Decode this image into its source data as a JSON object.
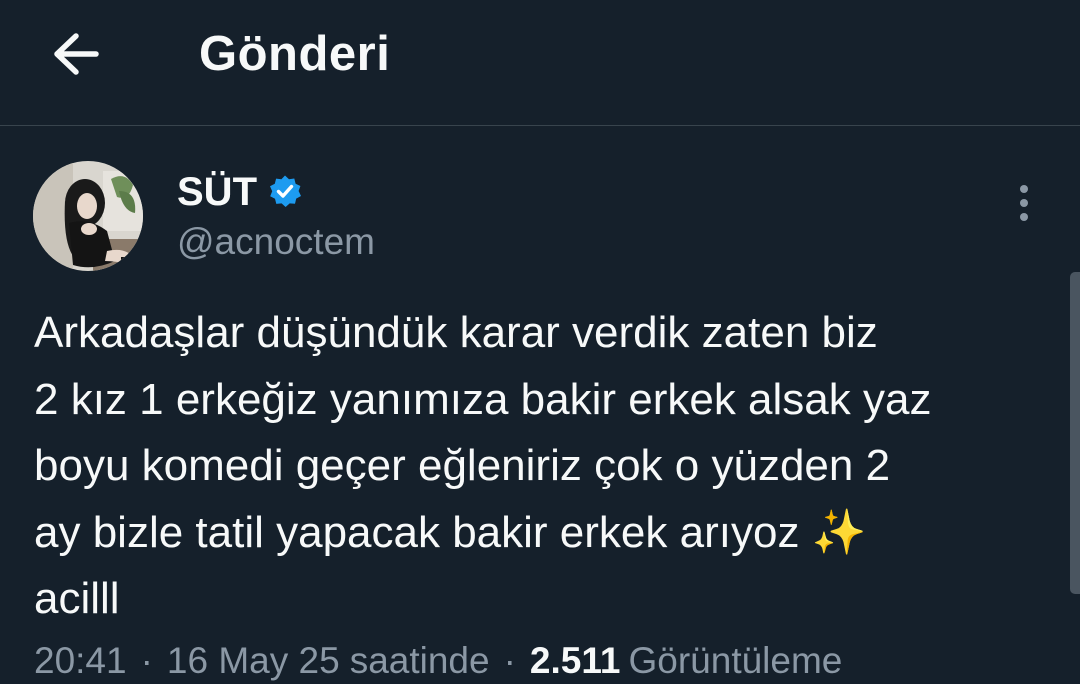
{
  "header": {
    "title": "Gönderi"
  },
  "post": {
    "author": {
      "display_name": "SÜT",
      "handle": "@acnoctem",
      "verified": true
    },
    "text": "Arkadaşlar düşündük karar verdik zaten biz\n2 kız 1 erkeğiz yanımıza bakir erkek alsak yaz\nboyu komedi geçer eğleniriz çok o yüzden 2\nay bizle tatil yapacak bakir erkek arıyoz ✨\nacilll",
    "meta": {
      "time": "20:41",
      "separator": "·",
      "date": "16 May 25",
      "source": "saatinde",
      "views_count": "2.511",
      "views_label": "Görüntüleme"
    }
  },
  "colors": {
    "background": "#15202b",
    "text_primary": "#f7f9f9",
    "text_secondary": "#8b98a5",
    "divider": "#38444d",
    "verified_badge": "#1d9bf0"
  },
  "icons": {
    "back": "arrow-left-icon",
    "verified": "verified-badge-icon",
    "more": "more-vertical-icon"
  }
}
